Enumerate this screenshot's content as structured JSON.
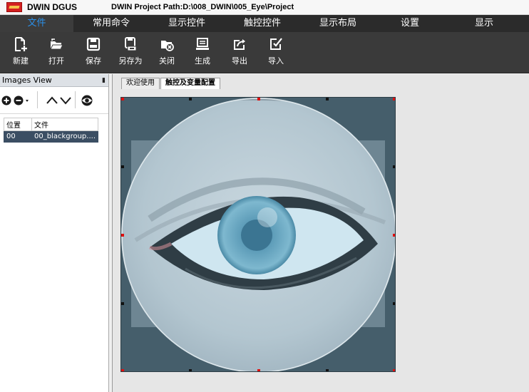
{
  "app": {
    "name": "DWIN DGUS",
    "project_path": "DWIN Project Path:D:\\008_DWIN\\005_Eye\\Project"
  },
  "menu": {
    "tabs": [
      {
        "label": "文件",
        "active": true
      },
      {
        "label": "常用命令",
        "active": false
      },
      {
        "label": "显示控件",
        "active": false
      },
      {
        "label": "触控控件",
        "active": false
      },
      {
        "label": "显示布局",
        "active": false
      },
      {
        "label": "设置",
        "active": false
      },
      {
        "label": "显示",
        "active": false
      }
    ]
  },
  "toolbar": {
    "items": [
      {
        "label": "新建",
        "icon": "new-file-icon"
      },
      {
        "label": "打开",
        "icon": "open-folder-icon"
      },
      {
        "label": "保存",
        "icon": "save-icon"
      },
      {
        "label": "另存为",
        "icon": "save-as-icon"
      },
      {
        "label": "关闭",
        "icon": "close-project-icon"
      },
      {
        "label": "生成",
        "icon": "generate-icon"
      },
      {
        "label": "导出",
        "icon": "export-icon"
      },
      {
        "label": "导入",
        "icon": "import-icon"
      }
    ]
  },
  "images_view": {
    "title": "Images View",
    "columns": [
      "位置",
      "文件"
    ],
    "rows": [
      {
        "position": "00",
        "file": "00_blackgroup...."
      }
    ]
  },
  "document_tabs": [
    {
      "label": "欢迎使用",
      "active": false
    },
    {
      "label": "触控及变量配置",
      "active": true
    }
  ],
  "colors": {
    "menubar_bg": "#2b2b2b",
    "toolbar_bg": "#3a3a3a",
    "active_tab_text": "#2b8fe8",
    "canvas_bg": "#455e6b",
    "selected_row_bg": "#3b4e63",
    "handle_red": "#e01010"
  }
}
